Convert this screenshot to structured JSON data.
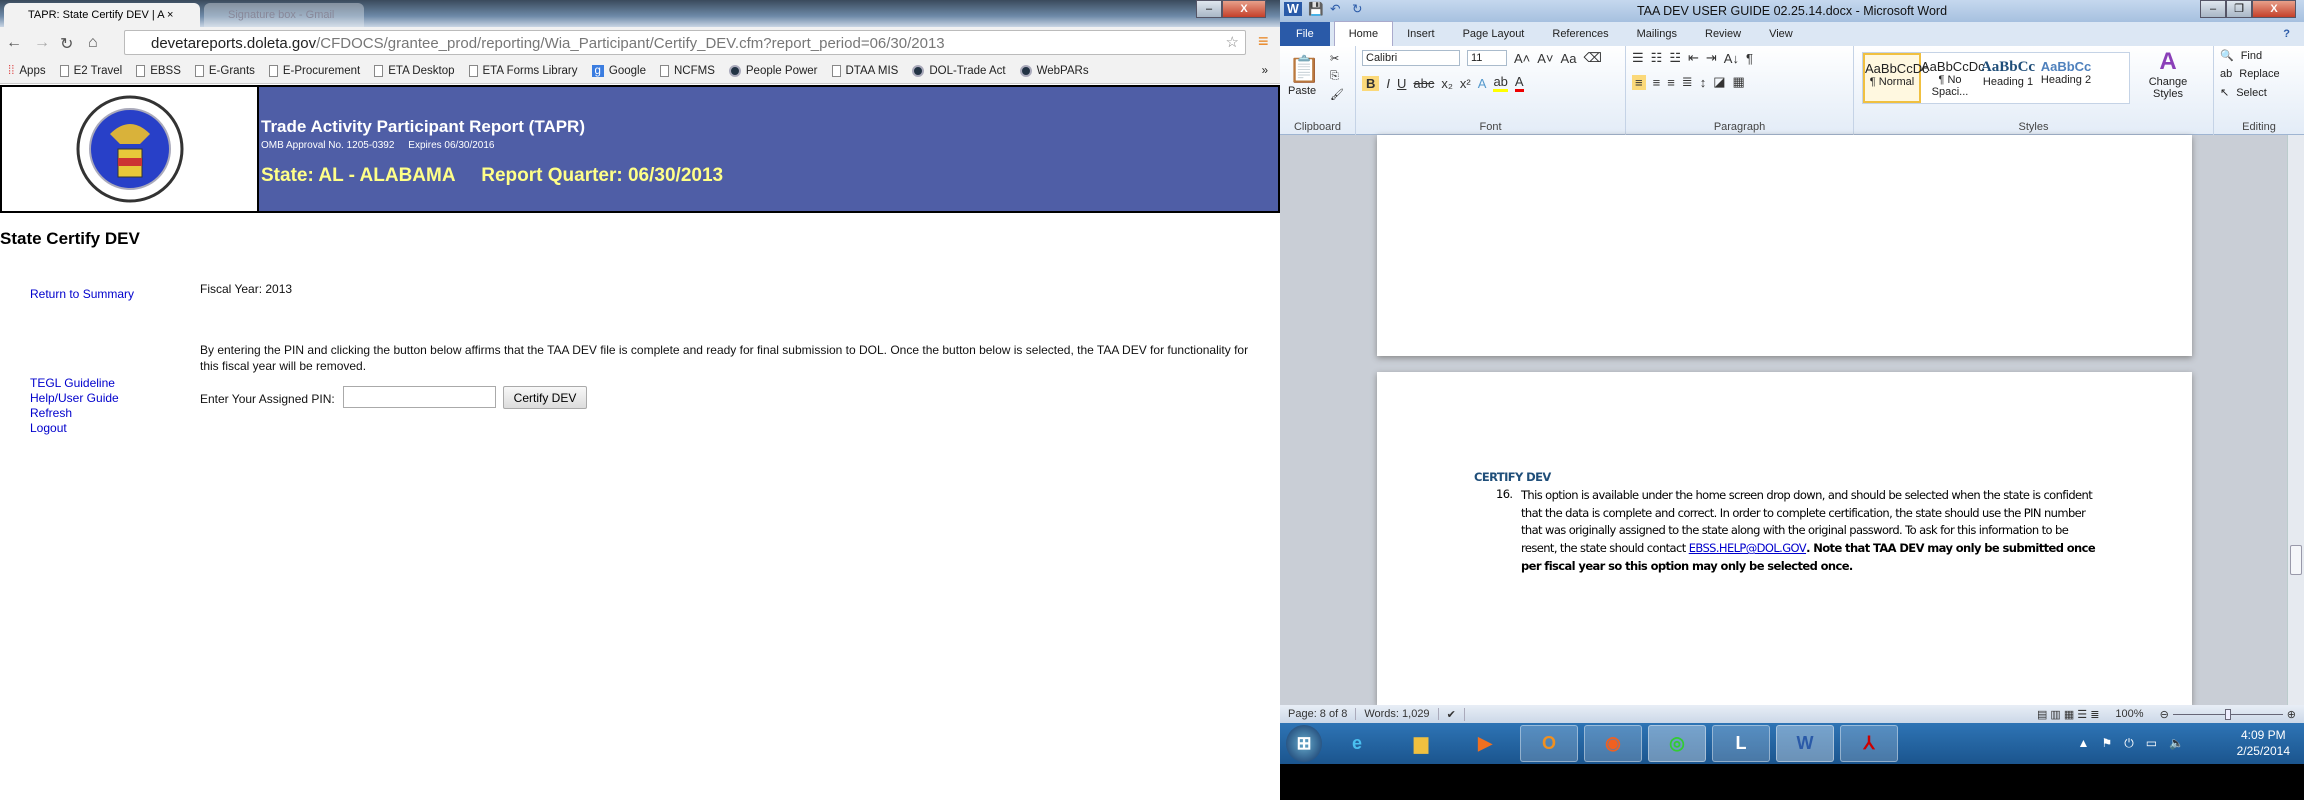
{
  "browser": {
    "tabs": [
      {
        "label": "TAPR: State Certify DEV | A"
      },
      {
        "label": "Signature box - Gmail"
      }
    ],
    "url_host": "devetareports.doleta.gov",
    "url_path": "/CFDOCS/grantee_prod/reporting/Wia_Participant/Certify_DEV.cfm?report_period=06/30/2013",
    "bookmarks": [
      "Apps",
      "E2 Travel",
      "EBSS",
      "E-Grants",
      "E-Procurement",
      "ETA Desktop",
      "ETA Forms Library",
      "Google",
      "NCFMS",
      "People Power",
      "DTAA MIS",
      "DOL-Trade Act",
      "WebPARs"
    ],
    "more": "»"
  },
  "page": {
    "header_title": "Trade Activity Participant Report (TAPR)",
    "omb": "OMB Approval No. 1205-0392     Expires 06/30/2016",
    "state_line": "State: AL - ALABAMA     Report Quarter: 06/30/2013",
    "title": "State Certify DEV",
    "return_link": "Return to Summary",
    "fiscal_year": "Fiscal Year: 2013",
    "notice": "By entering the PIN and clicking the button below affirms that the TAA DEV file is complete and ready for final submission to DOL. Once the button below is selected, the TAA DEV for functionality for this fiscal year will be removed.",
    "links": [
      "TEGL Guideline",
      "Help/User Guide",
      "Refresh",
      "Logout"
    ],
    "pin_label": "Enter Your Assigned PIN:",
    "pin_value": "",
    "certify_button": "Certify DEV"
  },
  "word": {
    "title": "TAA DEV USER GUIDE 02.25.14.docx - Microsoft Word",
    "tabs": [
      "File",
      "Home",
      "Insert",
      "Page Layout",
      "References",
      "Mailings",
      "Review",
      "View"
    ],
    "font": "Calibri",
    "size": "11",
    "groups": [
      "Clipboard",
      "Font",
      "Paragraph",
      "Styles",
      "Editing"
    ],
    "paste": "Paste",
    "styles": [
      "AaBbCcDc",
      "AaBbCcDc",
      "AaBbCc",
      "AaBbCc"
    ],
    "style_names": [
      "¶ Normal",
      "¶ No Spaci...",
      "Heading 1",
      "Heading 2"
    ],
    "change_styles": "Change Styles",
    "editing": [
      "Find",
      "Replace",
      "Select"
    ],
    "doc": {
      "heading": "CERTIFY DEV",
      "number": "16.",
      "text": "This option is available under the home screen drop down, and should be selected when the state is confident that the data is complete and correct. In order to complete certification, the state should use the PIN number that was originally assigned to the state along with the original password. To ask for this information to be resent, the state should contact ",
      "email": "EBSS.HELP@DOL.GOV",
      "bold": ". Note that TAA DEV may only be submitted once per fiscal year so this option may only be selected once."
    },
    "status": {
      "page": "Page: 8 of 8",
      "words": "Words: 1,029",
      "zoom": "100%",
      "zoom_level": 100
    }
  },
  "taskbar": {
    "time": "4:09 PM",
    "date": "2/25/2014"
  },
  "colors": {
    "header_band": "#4f5ea6",
    "state_text": "#ffff88",
    "link": "#0000cc",
    "heading": "#1f4e79"
  }
}
